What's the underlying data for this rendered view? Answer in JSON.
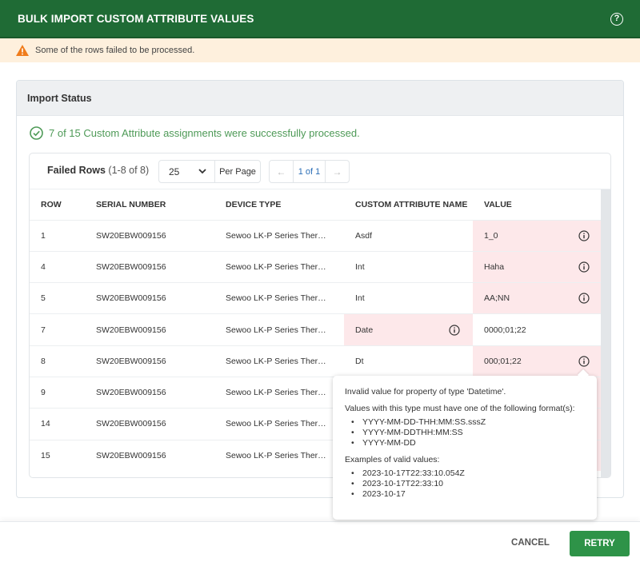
{
  "header": {
    "title": "BULK IMPORT CUSTOM ATTRIBUTE VALUES",
    "help_icon": "question-circle-icon"
  },
  "warning": {
    "icon": "warning-triangle-icon",
    "text": "Some of the rows failed to be processed.",
    "color": "#f07c1b"
  },
  "status": {
    "title": "Import Status",
    "success_icon": "check-circle-icon",
    "success_text": "7 of 15 Custom Attribute assignments were successfully processed."
  },
  "failed_rows": {
    "title": "Failed Rows",
    "count": "(1-8 of 8)",
    "per_page_value": "25",
    "per_page_label": "Per Page",
    "pager": {
      "prev": "←",
      "info": "1 of 1",
      "next": "→"
    },
    "columns": [
      "ROW",
      "SERIAL NUMBER",
      "DEVICE TYPE",
      "CUSTOM ATTRIBUTE NAME",
      "VALUE"
    ],
    "rows": [
      {
        "row": "1",
        "serial": "SW20EBW009156",
        "device": "Sewoo LK-P Series Ther…",
        "attr": "Asdf",
        "value": "1_0",
        "error": "value"
      },
      {
        "row": "4",
        "serial": "SW20EBW009156",
        "device": "Sewoo LK-P Series Ther…",
        "attr": "Int",
        "value": "Haha",
        "error": "value"
      },
      {
        "row": "5",
        "serial": "SW20EBW009156",
        "device": "Sewoo LK-P Series Ther…",
        "attr": "Int",
        "value": "AA;NN",
        "error": "value"
      },
      {
        "row": "7",
        "serial": "SW20EBW009156",
        "device": "Sewoo LK-P Series Ther…",
        "attr": "Date",
        "value": "0000;01;22",
        "error": "attr"
      },
      {
        "row": "8",
        "serial": "SW20EBW009156",
        "device": "Sewoo LK-P Series Ther…",
        "attr": "Dt",
        "value": "000;01;22",
        "error": "value"
      },
      {
        "row": "9",
        "serial": "SW20EBW009156",
        "device": "Sewoo LK-P Series Ther…",
        "attr": "",
        "value": "",
        "error": "value"
      },
      {
        "row": "14",
        "serial": "SW20EBW009156",
        "device": "Sewoo LK-P Series Ther…",
        "attr": "",
        "value": "",
        "error": "value"
      },
      {
        "row": "15",
        "serial": "SW20EBW009156",
        "device": "Sewoo LK-P Series Ther…",
        "attr": "",
        "value": "",
        "error": "value"
      }
    ]
  },
  "tooltip": {
    "heading": "Invalid value for property of type 'Datetime'.",
    "formats_label": "Values with this type must have one of the following format(s):",
    "formats": [
      "YYYY-MM-DD-THH:MM:SS.sssZ",
      "YYYY-MM-DDTHH:MM:SS",
      "YYYY-MM-DD"
    ],
    "examples_label": "Examples of valid values:",
    "examples": [
      "2023-10-17T22:33:10.054Z",
      "2023-10-17T22:33:10",
      "2023-10-17"
    ]
  },
  "footer": {
    "cancel": "CANCEL",
    "retry": "RETRY"
  }
}
